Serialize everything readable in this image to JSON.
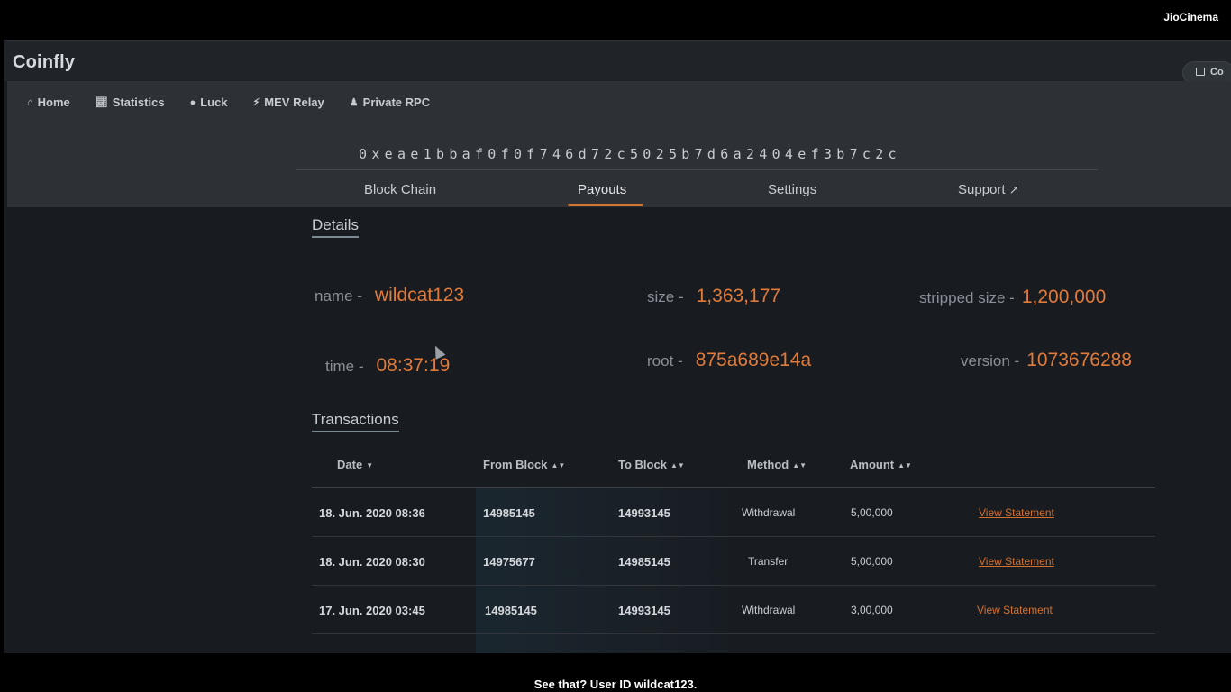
{
  "overlay": {
    "watermark": "JioCinema",
    "caption": "See that? User ID wildcat123."
  },
  "app": {
    "logo": "Coinfly",
    "connect_label": "Co"
  },
  "nav": [
    {
      "label": "Home",
      "icon": "home-icon"
    },
    {
      "label": "Statistics",
      "icon": "chart-icon"
    },
    {
      "label": "Luck",
      "icon": "coins-icon"
    },
    {
      "label": "MEV Relay",
      "icon": "bolt-icon"
    },
    {
      "label": "Private RPC",
      "icon": "user-lock-icon"
    }
  ],
  "address": "0xeae1bbaf0f0f746d72c5025b7d6a2404ef3b7c2c",
  "tabs": [
    {
      "label": "Block Chain",
      "active": false
    },
    {
      "label": "Payouts",
      "active": true
    },
    {
      "label": "Settings",
      "active": false
    },
    {
      "label": "Support",
      "active": false,
      "icon": "external-link-icon"
    }
  ],
  "details": {
    "title": "Details",
    "name_label": "name -",
    "name_value": "wildcat123",
    "size_label": "size -",
    "size_value": "1,363,177",
    "stripped_label": "stripped size -",
    "stripped_value": "1,200,000",
    "time_label": "time -",
    "time_value": "08:37:19",
    "root_label": "root -",
    "root_value": "875a689e14a",
    "version_label": "version -",
    "version_value": "1073676288"
  },
  "transactions": {
    "title": "Transactions",
    "columns": [
      "Date",
      "From Block",
      "To Block",
      "Method",
      "Amount"
    ],
    "rows": [
      {
        "date": "18. Jun. 2020 08:36",
        "from": "14985145",
        "to": "14993145",
        "method": "Withdrawal",
        "amount": "5,00,000",
        "action": "View Statement"
      },
      {
        "date": "18. Jun. 2020 08:30",
        "from": "14975677",
        "to": "14985145",
        "method": "Transfer",
        "amount": "5,00,000",
        "action": "View Statement"
      },
      {
        "date": "17. Jun. 2020 03:45",
        "from": "14985145",
        "to": "14993145",
        "method": "Withdrawal",
        "amount": "3,00,000",
        "action": "View Statement"
      }
    ]
  },
  "colors": {
    "accent": "#e07b3a",
    "background": "#181b20",
    "header": "#2d3035"
  }
}
